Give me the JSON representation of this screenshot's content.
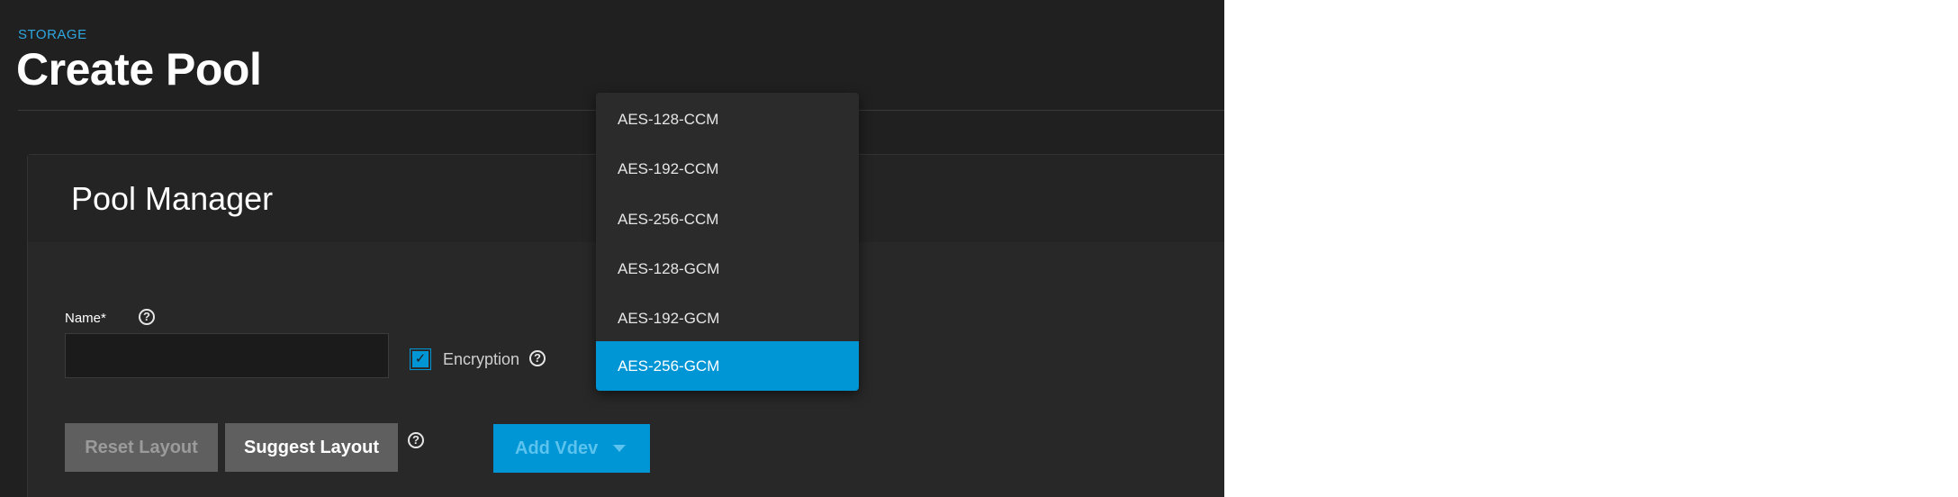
{
  "header": {
    "breadcrumb": "STORAGE",
    "title": "Create Pool"
  },
  "card": {
    "title": "Pool Manager"
  },
  "form": {
    "name_label": "Name*",
    "name_value": "",
    "encryption_label": "Encryption",
    "encryption_checked": true,
    "help_glyph": "?"
  },
  "buttons": {
    "reset_label": "Reset Layout",
    "suggest_label": "Suggest Layout",
    "add_vdev_label": "Add Vdev"
  },
  "encryption_dropdown": {
    "options": [
      "AES-128-CCM",
      "AES-192-CCM",
      "AES-256-CCM",
      "AES-128-GCM",
      "AES-192-GCM",
      "AES-256-GCM"
    ],
    "selected": "AES-256-GCM"
  },
  "icons": {
    "check": "check-icon",
    "help": "help-circle-icon",
    "caret": "caret-down-icon"
  },
  "colors": {
    "accent": "#0095d5",
    "background": "#202020",
    "card": "#282828",
    "breadcrumb": "#2ea7e0"
  }
}
